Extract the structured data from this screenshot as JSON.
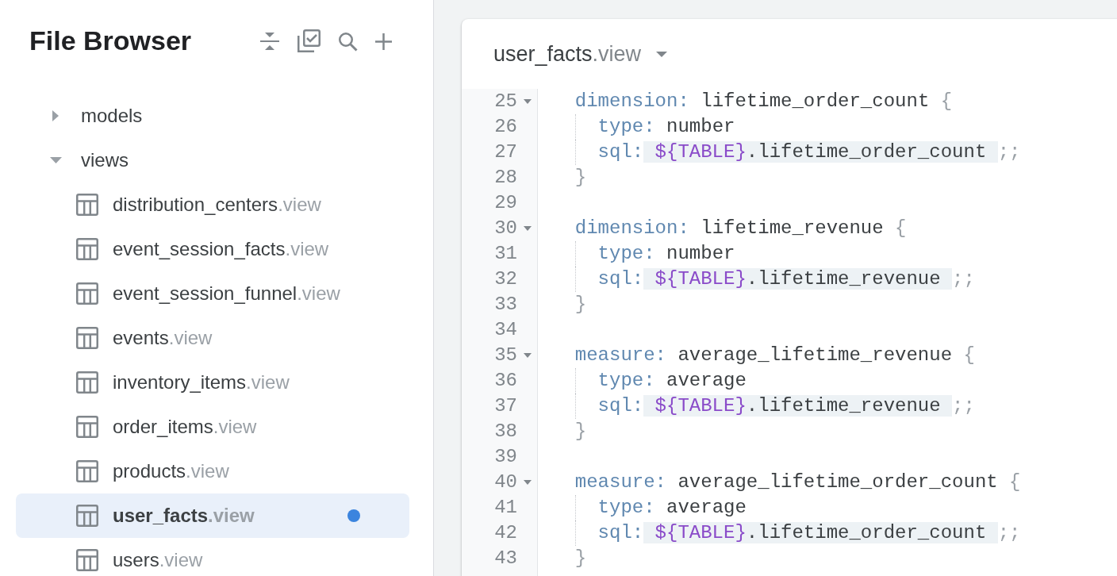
{
  "sidebar": {
    "title": "File Browser",
    "tree": [
      {
        "label": "models",
        "expanded": false
      },
      {
        "label": "views",
        "expanded": true,
        "children": [
          {
            "name": "distribution_centers",
            "extension": ".view",
            "selected": false,
            "unsaved": false
          },
          {
            "name": "event_session_facts",
            "extension": ".view",
            "selected": false,
            "unsaved": false
          },
          {
            "name": "event_session_funnel",
            "extension": ".view",
            "selected": false,
            "unsaved": false
          },
          {
            "name": "events",
            "extension": ".view",
            "selected": false,
            "unsaved": false
          },
          {
            "name": "inventory_items",
            "extension": ".view",
            "selected": false,
            "unsaved": false
          },
          {
            "name": "order_items",
            "extension": ".view",
            "selected": false,
            "unsaved": false
          },
          {
            "name": "products",
            "extension": ".view",
            "selected": false,
            "unsaved": false
          },
          {
            "name": "user_facts",
            "extension": ".view",
            "selected": true,
            "unsaved": true
          },
          {
            "name": "users",
            "extension": ".view",
            "selected": false,
            "unsaved": false
          }
        ]
      }
    ]
  },
  "editor": {
    "file": {
      "name": "user_facts",
      "extension": ".view"
    },
    "lines": [
      {
        "number": "25",
        "foldable": true,
        "kind": "open",
        "key": "dimension:",
        "value": "lifetime_order_count",
        "brace": "{"
      },
      {
        "number": "26",
        "foldable": false,
        "kind": "property",
        "key": "type:",
        "value": "number"
      },
      {
        "number": "27",
        "foldable": false,
        "kind": "sql",
        "key": "sql:",
        "reference": "${TABLE}",
        "value": ".lifetime_order_count",
        "terminator": ";;"
      },
      {
        "number": "28",
        "foldable": false,
        "kind": "close",
        "brace": "}"
      },
      {
        "number": "29",
        "foldable": false,
        "kind": "blank"
      },
      {
        "number": "30",
        "foldable": true,
        "kind": "open",
        "key": "dimension:",
        "value": "lifetime_revenue",
        "brace": "{"
      },
      {
        "number": "31",
        "foldable": false,
        "kind": "property",
        "key": "type:",
        "value": "number"
      },
      {
        "number": "32",
        "foldable": false,
        "kind": "sql",
        "key": "sql:",
        "reference": "${TABLE}",
        "value": ".lifetime_revenue",
        "terminator": ";;"
      },
      {
        "number": "33",
        "foldable": false,
        "kind": "close",
        "brace": "}"
      },
      {
        "number": "34",
        "foldable": false,
        "kind": "blank"
      },
      {
        "number": "35",
        "foldable": true,
        "kind": "open",
        "key": "measure:",
        "value": "average_lifetime_revenue",
        "brace": "{"
      },
      {
        "number": "36",
        "foldable": false,
        "kind": "property",
        "key": "type:",
        "value": "average"
      },
      {
        "number": "37",
        "foldable": false,
        "kind": "sql",
        "key": "sql:",
        "reference": "${TABLE}",
        "value": ".lifetime_revenue",
        "terminator": ";;"
      },
      {
        "number": "38",
        "foldable": false,
        "kind": "close",
        "brace": "}"
      },
      {
        "number": "39",
        "foldable": false,
        "kind": "blank"
      },
      {
        "number": "40",
        "foldable": true,
        "kind": "open",
        "key": "measure:",
        "value": "average_lifetime_order_count",
        "brace": "{"
      },
      {
        "number": "41",
        "foldable": false,
        "kind": "property",
        "key": "type:",
        "value": "average"
      },
      {
        "number": "42",
        "foldable": false,
        "kind": "sql",
        "key": "sql:",
        "reference": "${TABLE}",
        "value": ".lifetime_order_count",
        "terminator": ";;"
      },
      {
        "number": "43",
        "foldable": false,
        "kind": "close",
        "brace": "}"
      }
    ]
  }
}
